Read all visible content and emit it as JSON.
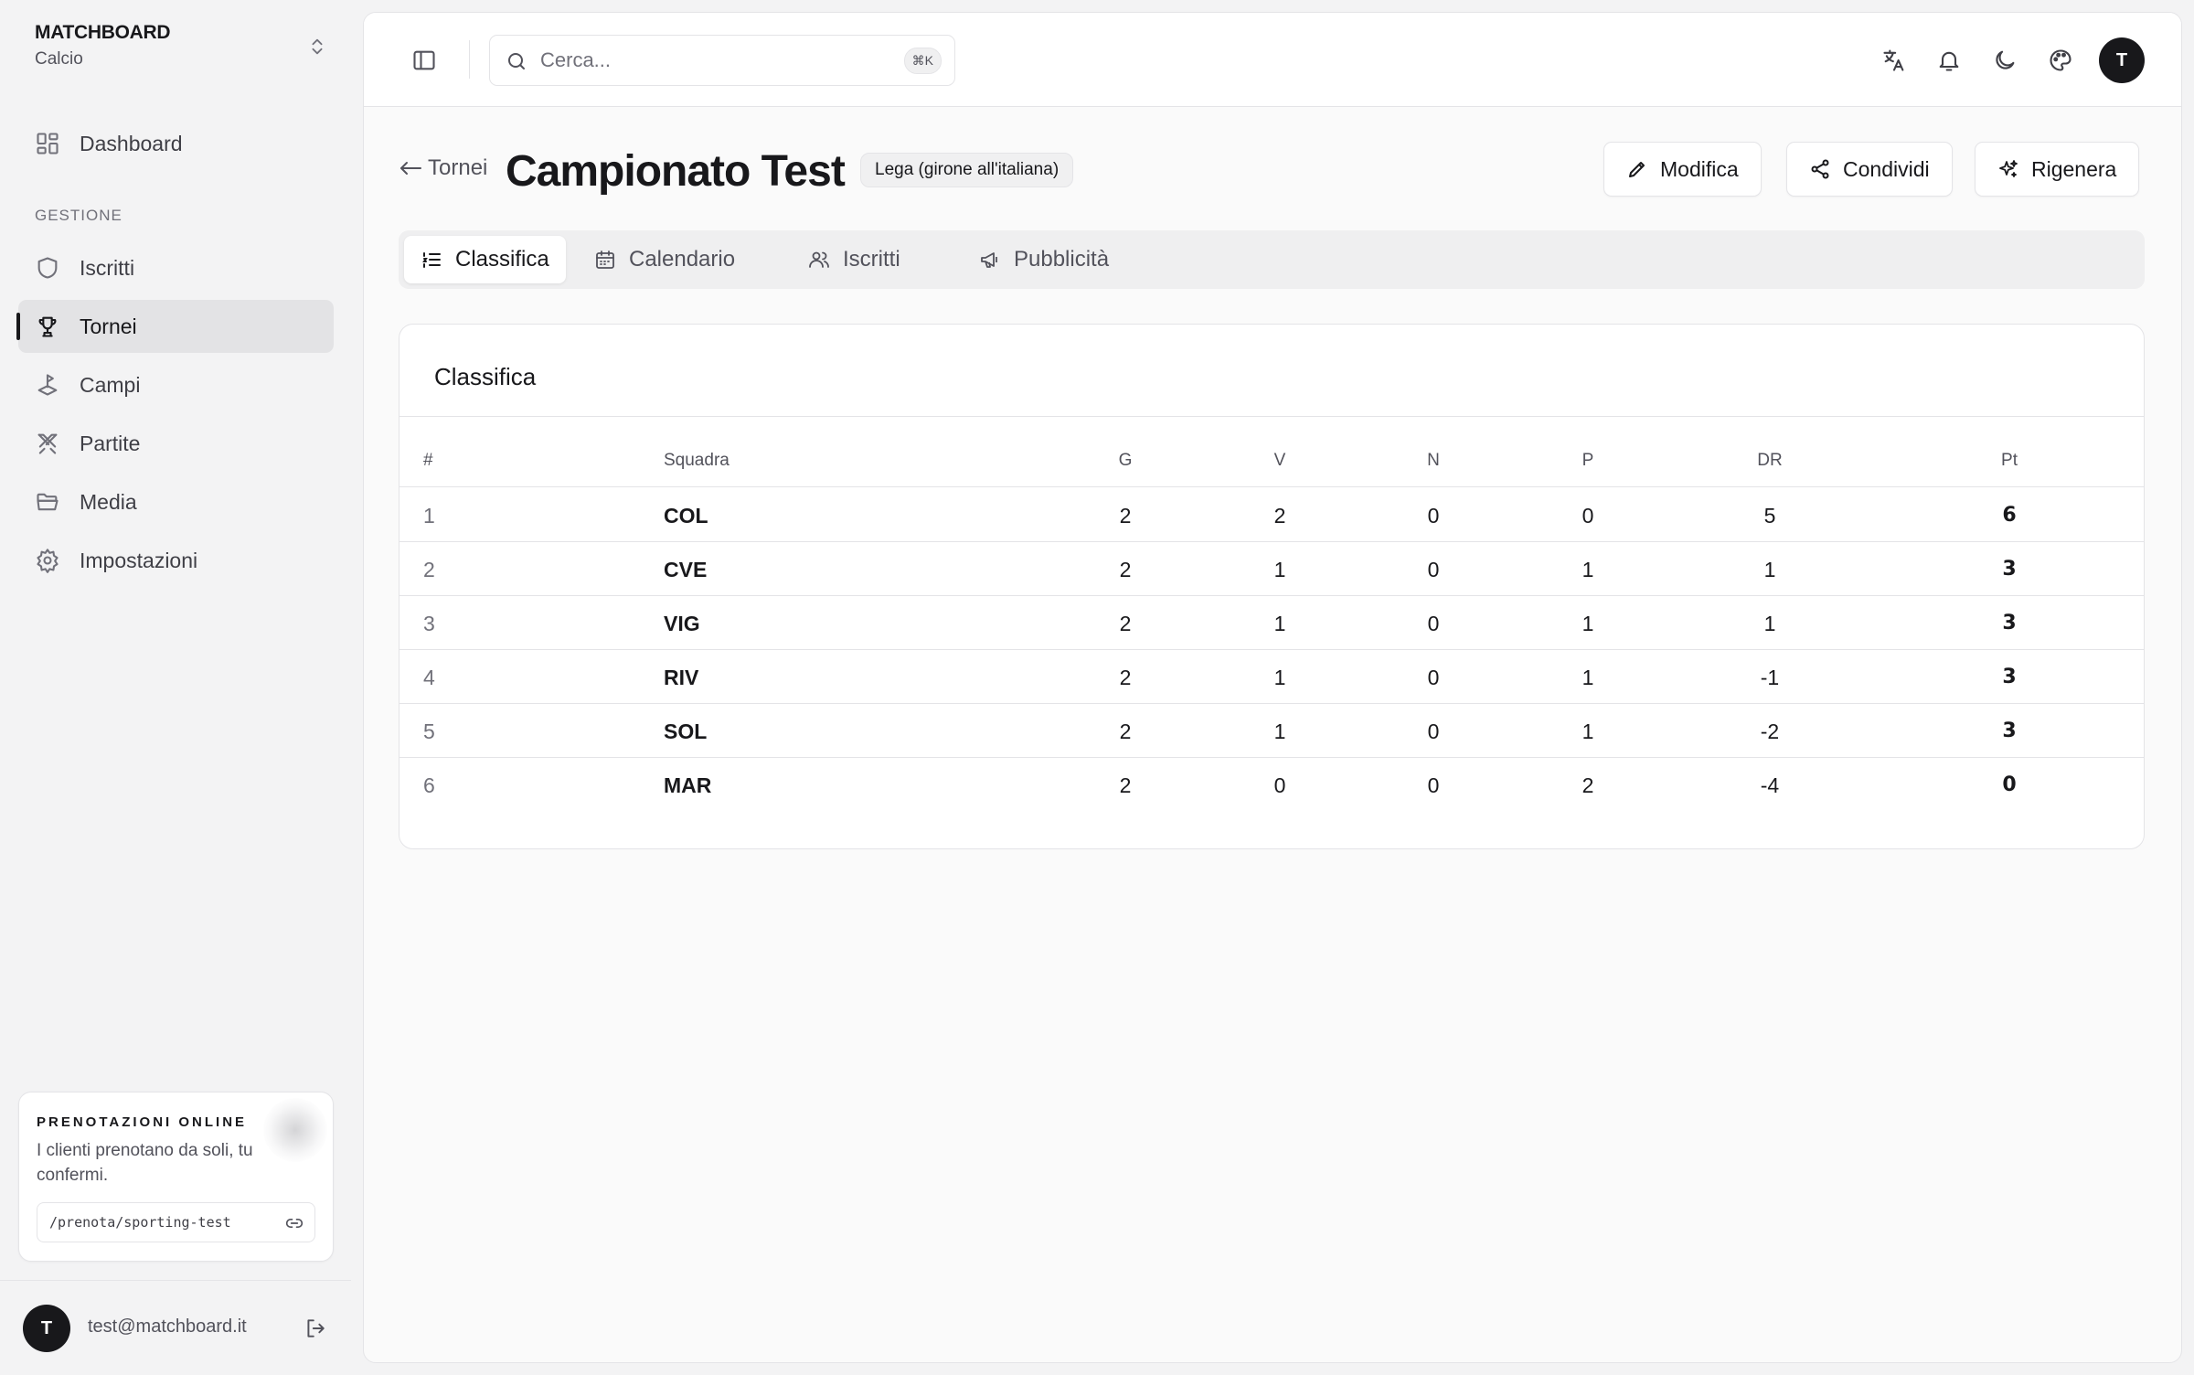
{
  "sidebar": {
    "brand_name": "MATCHBOARD",
    "brand_sub": "Calcio",
    "dashboard_label": "Dashboard",
    "section_label": "GESTIONE",
    "items": [
      {
        "label": "Iscritti",
        "icon": "shield-icon"
      },
      {
        "label": "Tornei",
        "icon": "trophy-icon",
        "active": true
      },
      {
        "label": "Campi",
        "icon": "field-icon"
      },
      {
        "label": "Partite",
        "icon": "swords-icon"
      },
      {
        "label": "Media",
        "icon": "folder-icon"
      },
      {
        "label": "Impostazioni",
        "icon": "gear-icon"
      }
    ],
    "promo": {
      "title": "PRENOTAZIONI ONLINE",
      "text": "I clienti prenotano da soli, tu confermi.",
      "link": "/prenota/sporting-test"
    },
    "user_initial": "T",
    "user_email": "test@matchboard.it"
  },
  "topbar": {
    "search_placeholder": "Cerca...",
    "search_shortcut": "⌘K",
    "avatar_initial": "T"
  },
  "header": {
    "back_label": "Tornei",
    "title": "Campionato Test",
    "badge": "Lega (girone all'italiana)",
    "actions": {
      "edit": "Modifica",
      "share": "Condividi",
      "regenerate": "Rigenera"
    }
  },
  "tabs": [
    {
      "label": "Classifica",
      "icon": "list-icon",
      "active": true
    },
    {
      "label": "Calendario",
      "icon": "calendar-icon"
    },
    {
      "label": "Iscritti",
      "icon": "users-icon"
    },
    {
      "label": "Pubblicità",
      "icon": "megaphone-icon"
    }
  ],
  "standings": {
    "title": "Classifica",
    "columns": {
      "rank": "#",
      "team": "Squadra",
      "g": "G",
      "v": "V",
      "n": "N",
      "p": "P",
      "dr": "DR",
      "pt": "Pt"
    },
    "rows": [
      {
        "rank": "1",
        "team": "COL",
        "g": "2",
        "v": "2",
        "n": "0",
        "p": "0",
        "dr": "5",
        "pt": "6"
      },
      {
        "rank": "2",
        "team": "CVE",
        "g": "2",
        "v": "1",
        "n": "0",
        "p": "1",
        "dr": "1",
        "pt": "3"
      },
      {
        "rank": "3",
        "team": "VIG",
        "g": "2",
        "v": "1",
        "n": "0",
        "p": "1",
        "dr": "1",
        "pt": "3"
      },
      {
        "rank": "4",
        "team": "RIV",
        "g": "2",
        "v": "1",
        "n": "0",
        "p": "1",
        "dr": "-1",
        "pt": "3"
      },
      {
        "rank": "5",
        "team": "SOL",
        "g": "2",
        "v": "1",
        "n": "0",
        "p": "1",
        "dr": "-2",
        "pt": "3"
      },
      {
        "rank": "6",
        "team": "MAR",
        "g": "2",
        "v": "0",
        "n": "0",
        "p": "2",
        "dr": "-4",
        "pt": "0"
      }
    ]
  }
}
